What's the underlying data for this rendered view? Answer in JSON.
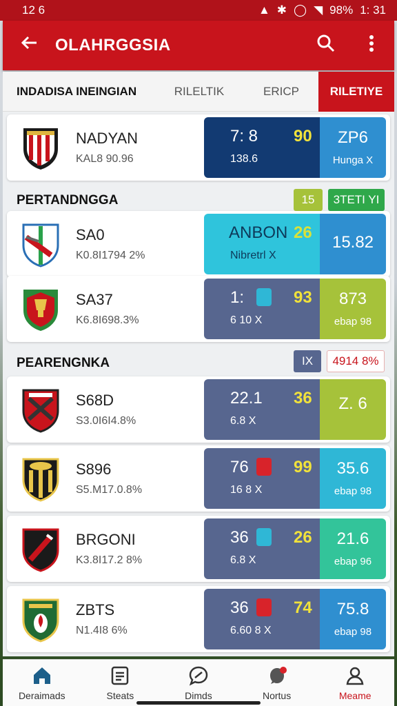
{
  "status_bar": {
    "time": "12 6",
    "battery": "98%",
    "clock": "1: 31"
  },
  "app_bar": {
    "title": "OLAHRGGSIA"
  },
  "tabs": [
    {
      "label": "INDADISA INEINGIAN"
    },
    {
      "label": "RILELTIK"
    },
    {
      "label": "ERICP"
    },
    {
      "label": "RILETIYE"
    }
  ],
  "sections": [
    {
      "title": "PERTANDNGGA",
      "pill1": "15",
      "pill2": "3TETI YI"
    },
    {
      "title": "PEARENGNKA",
      "pill1": "IX",
      "pill2": "4914 8%"
    }
  ],
  "teams": [
    {
      "name": "NADYAN",
      "sub": "KAL8 90.96",
      "score": "7: 8",
      "highlight": "90",
      "score_sub": "138.6",
      "right_big": "ZP6",
      "right_small": "Hunga X"
    },
    {
      "name": "SA0",
      "sub": "K0.8I1794 2%",
      "score": "ANBON",
      "highlight": "26",
      "score_sub": "Nibretrl X",
      "right_big": "15.82",
      "right_small": ""
    },
    {
      "name": "SA37",
      "sub": "K6.8I698.3%",
      "score": "1:",
      "highlight": "93",
      "score_sub": "6 10 X",
      "right_big": "873",
      "right_small": "ebap 98"
    },
    {
      "name": "S68D",
      "sub": "S3.0I6I4.8%",
      "score": "22.1",
      "highlight": "36",
      "score_sub": "6.8 X",
      "right_big": "Z. 6",
      "right_small": ""
    },
    {
      "name": "S896",
      "sub": "S5.M17.0.8%",
      "score": "76",
      "highlight": "99",
      "score_sub": "16 8 X",
      "right_big": "35.6",
      "right_small": "ebap 98"
    },
    {
      "name": "BRGONI",
      "sub": "K3.8I17.2 8%",
      "score": "36",
      "highlight": "26",
      "score_sub": "6.8 X",
      "right_big": "21.6",
      "right_small": "ebap 96"
    },
    {
      "name": "ZBTS",
      "sub": "N1.4I8 6%",
      "score": "36",
      "highlight": "74",
      "score_sub": "6.60 8 X",
      "right_big": "75.8",
      "right_small": "ebap 98"
    }
  ],
  "bottom_nav": [
    {
      "label": "Deraimads",
      "icon": "home-icon"
    },
    {
      "label": "Steats",
      "icon": "stats-icon"
    },
    {
      "label": "Dimds",
      "icon": "chat-icon"
    },
    {
      "label": "Nortus",
      "icon": "notification-icon"
    },
    {
      "label": "Meame",
      "icon": "profile-icon"
    }
  ],
  "colors": {
    "brand": "#c8141c",
    "navy": "#123a72",
    "slate": "#57668f",
    "teal": "#2fb7d6",
    "lime": "#a6c23a",
    "blue": "#2f8fd0",
    "highlight": "#f1e23b"
  }
}
